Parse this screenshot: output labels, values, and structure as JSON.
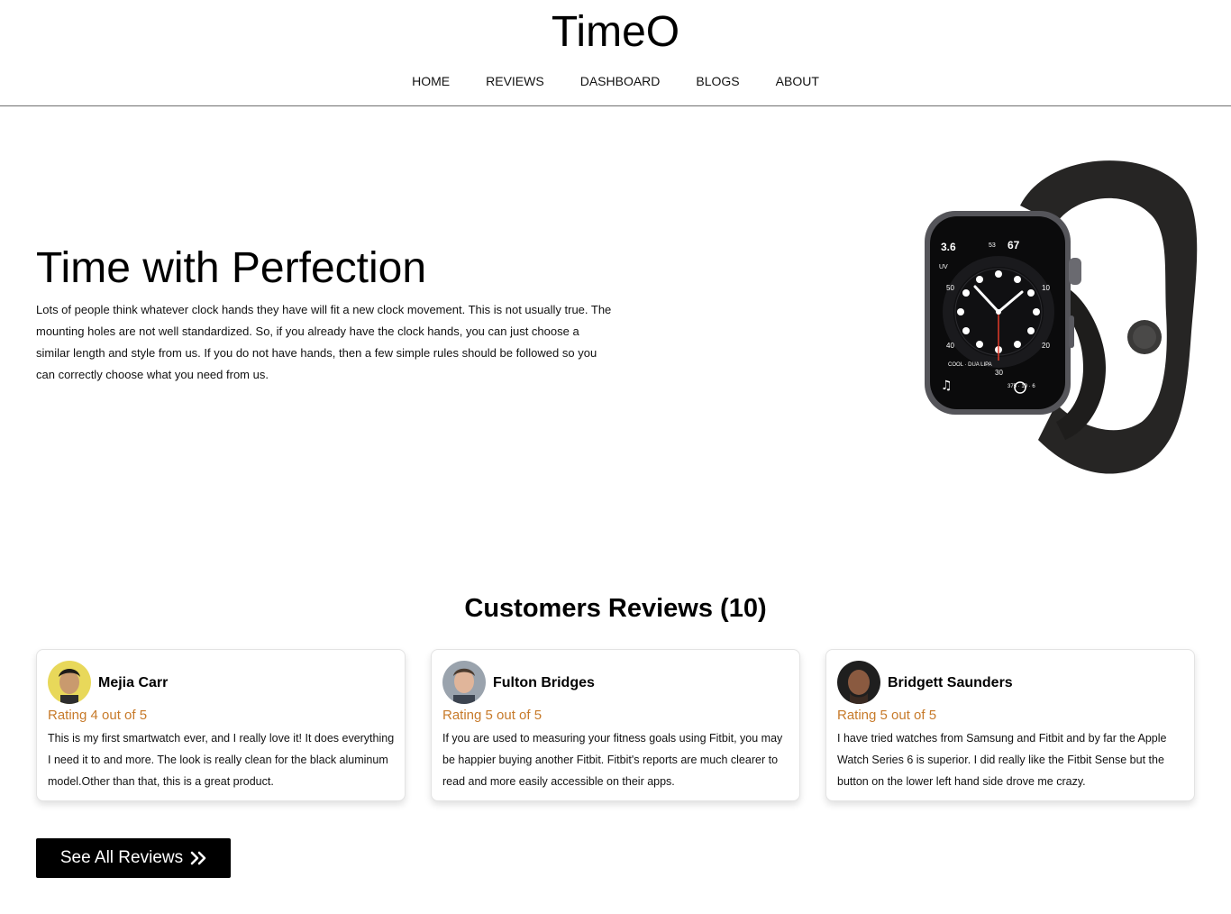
{
  "brand": "TimeO",
  "nav": [
    "HOME",
    "REVIEWS",
    "DASHBOARD",
    "BLOGS",
    "ABOUT"
  ],
  "hero": {
    "title": "Time with Perfection",
    "text": "Lots of people think whatever clock hands they have will fit a new clock movement. This is not usually true. The mounting holes are not well standardized. So, if you already have the clock hands, you can just choose a similar length and style from us. If you do not have hands, then a few simple rules should be followed so you can correctly choose what you need from us."
  },
  "watch_face": {
    "numbers": [
      "3.6",
      "53",
      "67",
      "50",
      "10",
      "40",
      "20",
      "30",
      "UV",
      "COOL · DUA LIPA",
      "375 · 19 · 6"
    ]
  },
  "reviews": {
    "heading": "Customers Reviews (10)",
    "items": [
      {
        "name": "Mejia Carr",
        "rating": "Rating 4 out of 5",
        "text": "This is my first smartwatch ever, and I really love it! It does everything I need it to and more. The look is really clean for the black aluminum model.Other than that, this is a great product."
      },
      {
        "name": "Fulton Bridges",
        "rating": "Rating 5 out of 5",
        "text": "If you are used to measuring your fitness goals using Fitbit, you may be happier buying another Fitbit. Fitbit's reports are much clearer to read and more easily accessible on their apps."
      },
      {
        "name": "Bridgett Saunders",
        "rating": "Rating 5 out of 5",
        "text": "I have tried watches from Samsung and Fitbit and by far the Apple Watch Series 6 is superior. I did really like the Fitbit Sense but the button on the lower left hand side drove me crazy."
      }
    ],
    "see_all": "See All Reviews"
  },
  "colors": {
    "rating": "#c77a2a",
    "button_bg": "#000000",
    "divider": "#6f6f6f"
  },
  "icons": [
    "double-chevron-right-icon",
    "watch-image",
    "avatar"
  ]
}
